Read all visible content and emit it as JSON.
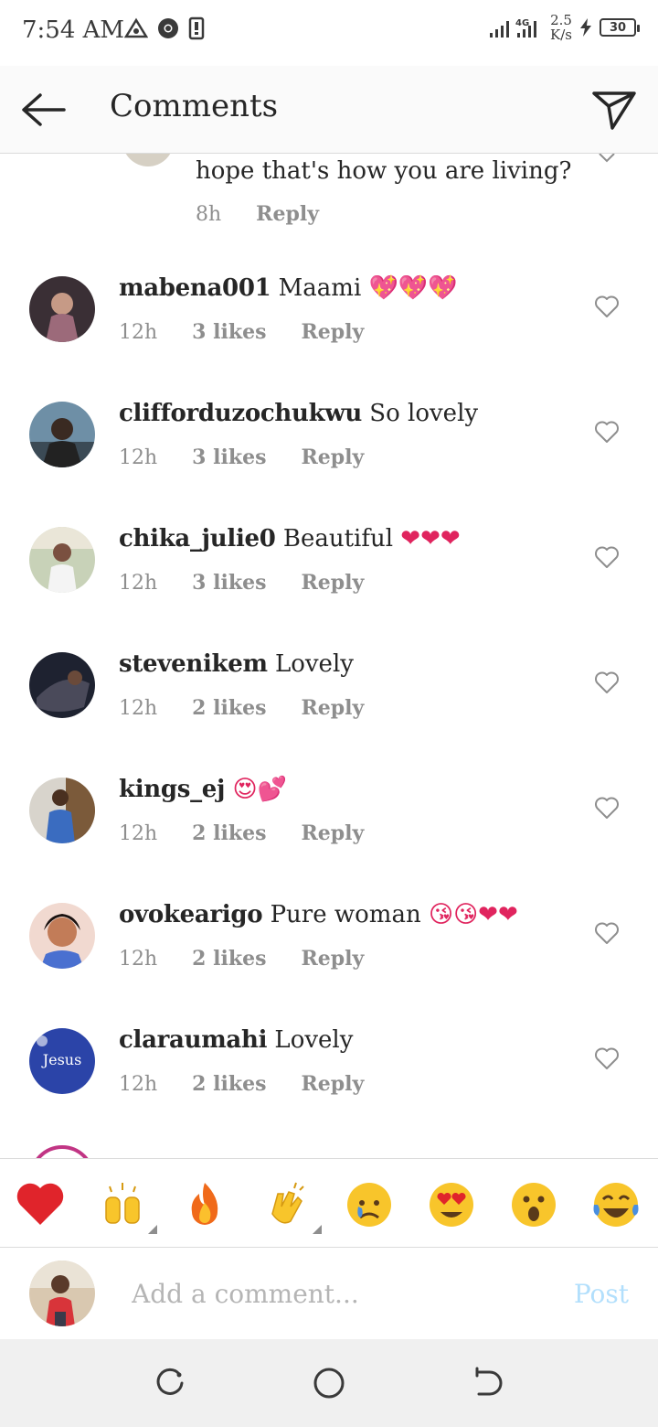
{
  "status_bar": {
    "time": "7:54 AM",
    "network_type": "4G",
    "net_speed_value": "2.5",
    "net_speed_unit": "K/s",
    "battery": "30",
    "icons": [
      "notification-icon",
      "chrome-icon",
      "sim-icon",
      "signal-icon",
      "charging-icon",
      "battery-icon"
    ]
  },
  "header": {
    "title": "Comments",
    "back_icon": "back-arrow-icon",
    "share_icon": "send-icon"
  },
  "partial_comment": {
    "text": "hope that's how you are living?",
    "time": "8h",
    "reply_label": "Reply"
  },
  "comments": [
    {
      "username": "mabena001",
      "text": "Maami",
      "emoji": "💖💖💖",
      "time": "12h",
      "likes": "3 likes",
      "reply": "Reply"
    },
    {
      "username": "clifforduzochukwu",
      "text": "So lovely",
      "emoji": "",
      "time": "12h",
      "likes": "3 likes",
      "reply": "Reply"
    },
    {
      "username": "chika_julie0",
      "text": "Beautiful",
      "emoji": "❤❤❤",
      "time": "12h",
      "likes": "3 likes",
      "reply": "Reply"
    },
    {
      "username": "stevenikem",
      "text": "Lovely",
      "emoji": "",
      "time": "12h",
      "likes": "2 likes",
      "reply": "Reply"
    },
    {
      "username": "kings_ej",
      "text": "",
      "emoji": "😍💕",
      "time": "12h",
      "likes": "2 likes",
      "reply": "Reply"
    },
    {
      "username": "ovokearigo",
      "text": "Pure woman",
      "emoji": "😘😘❤❤",
      "time": "12h",
      "likes": "2 likes",
      "reply": "Reply"
    },
    {
      "username": "claraumahi",
      "text": "Lovely",
      "emoji": "",
      "time": "12h",
      "likes": "2 likes",
      "reply": "Reply"
    }
  ],
  "emoji_bar": [
    "❤",
    "🙌",
    "🔥",
    "👏",
    "😢",
    "😍",
    "😮",
    "😂"
  ],
  "composer": {
    "placeholder": "Add a comment...",
    "post_label": "Post"
  },
  "colors": {
    "text": "#262626",
    "meta": "#8e8e8e",
    "post_disabled": "#b2dffc",
    "heart_red": "#ed4956"
  }
}
